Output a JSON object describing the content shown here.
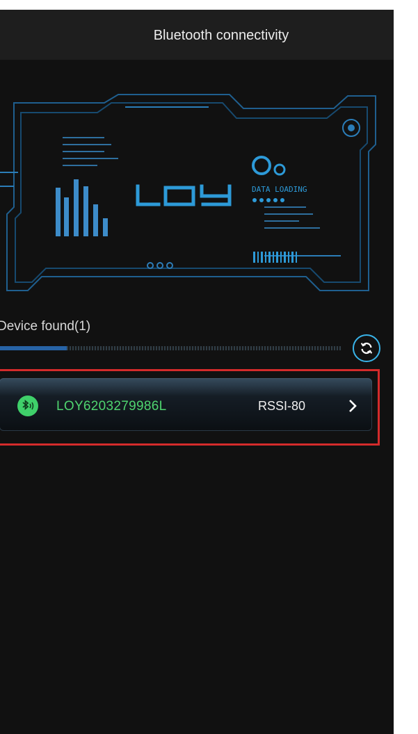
{
  "header": {
    "title": "Bluetooth connectivity"
  },
  "banner": {
    "logo_text": "LOY",
    "status_text": "DATA LOADING"
  },
  "devices_section": {
    "label": "Device found(1)",
    "refresh_icon": "refresh-icon"
  },
  "devices": [
    {
      "name": "LOY6203279986L",
      "rssi": "RSSI-80",
      "icon": "bluetooth-icon",
      "status_color": "#3fd06a"
    }
  ],
  "colors": {
    "background": "#111111",
    "header": "#1e1e1e",
    "accent_blue": "#39b3e8",
    "device_green": "#4fd46f",
    "highlight_red": "#d42b2b"
  }
}
